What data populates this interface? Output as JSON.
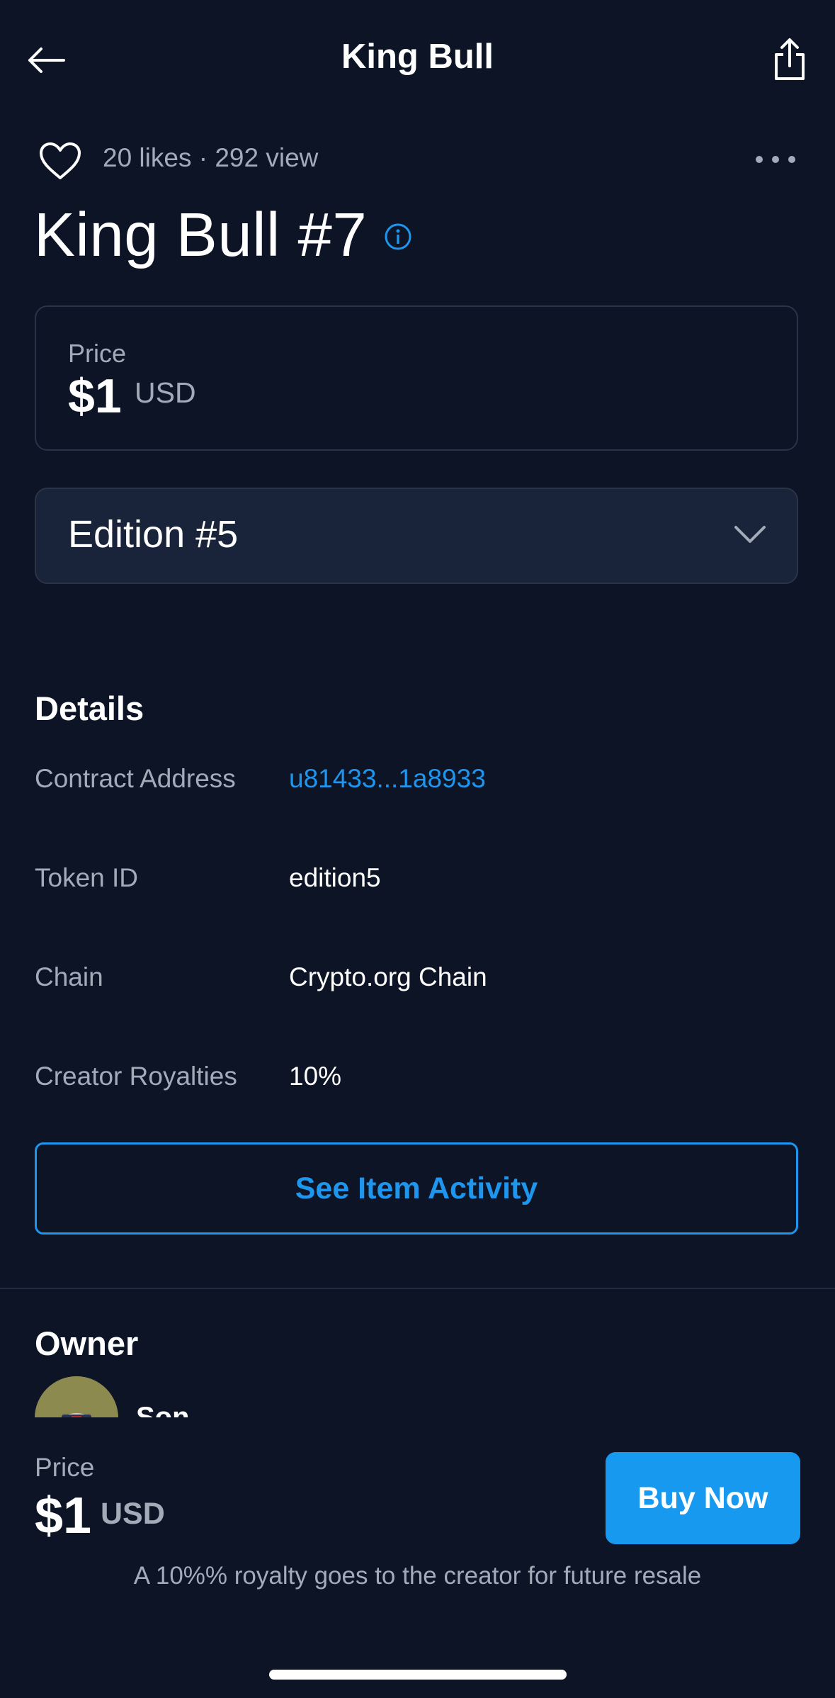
{
  "header": {
    "title": "King Bull",
    "back_icon": "arrow-left-icon",
    "share_icon": "share-icon"
  },
  "stats": {
    "likes_text": "20 likes · 292 view",
    "heart_icon": "heart-icon",
    "more_icon": "more-icon"
  },
  "item": {
    "title": "King Bull #7",
    "info_icon": "info-icon"
  },
  "price_card": {
    "label": "Price",
    "value": "$1",
    "currency": "USD"
  },
  "edition_select": {
    "selected": "Edition #5",
    "chevron_icon": "chevron-down-icon"
  },
  "details": {
    "title": "Details",
    "rows": [
      {
        "label": "Contract Address",
        "value": "u81433...1a8933"
      },
      {
        "label": "Token ID",
        "value": "edition5"
      },
      {
        "label": "Chain",
        "value": "Crypto.org Chain"
      },
      {
        "label": "Creator Royalties",
        "value": "10%"
      }
    ],
    "activity_button": "See Item Activity"
  },
  "owner": {
    "title": "Owner",
    "name": "Son"
  },
  "bottom": {
    "price_label": "Price",
    "price_value": "$1",
    "currency": "USD",
    "buy_button": "Buy Now",
    "royalty_note": "A 10%% royalty goes to the creator for future resale"
  },
  "colors": {
    "background": "#0c1426",
    "accent": "#1e96ee",
    "muted_text": "#a3abb8"
  }
}
